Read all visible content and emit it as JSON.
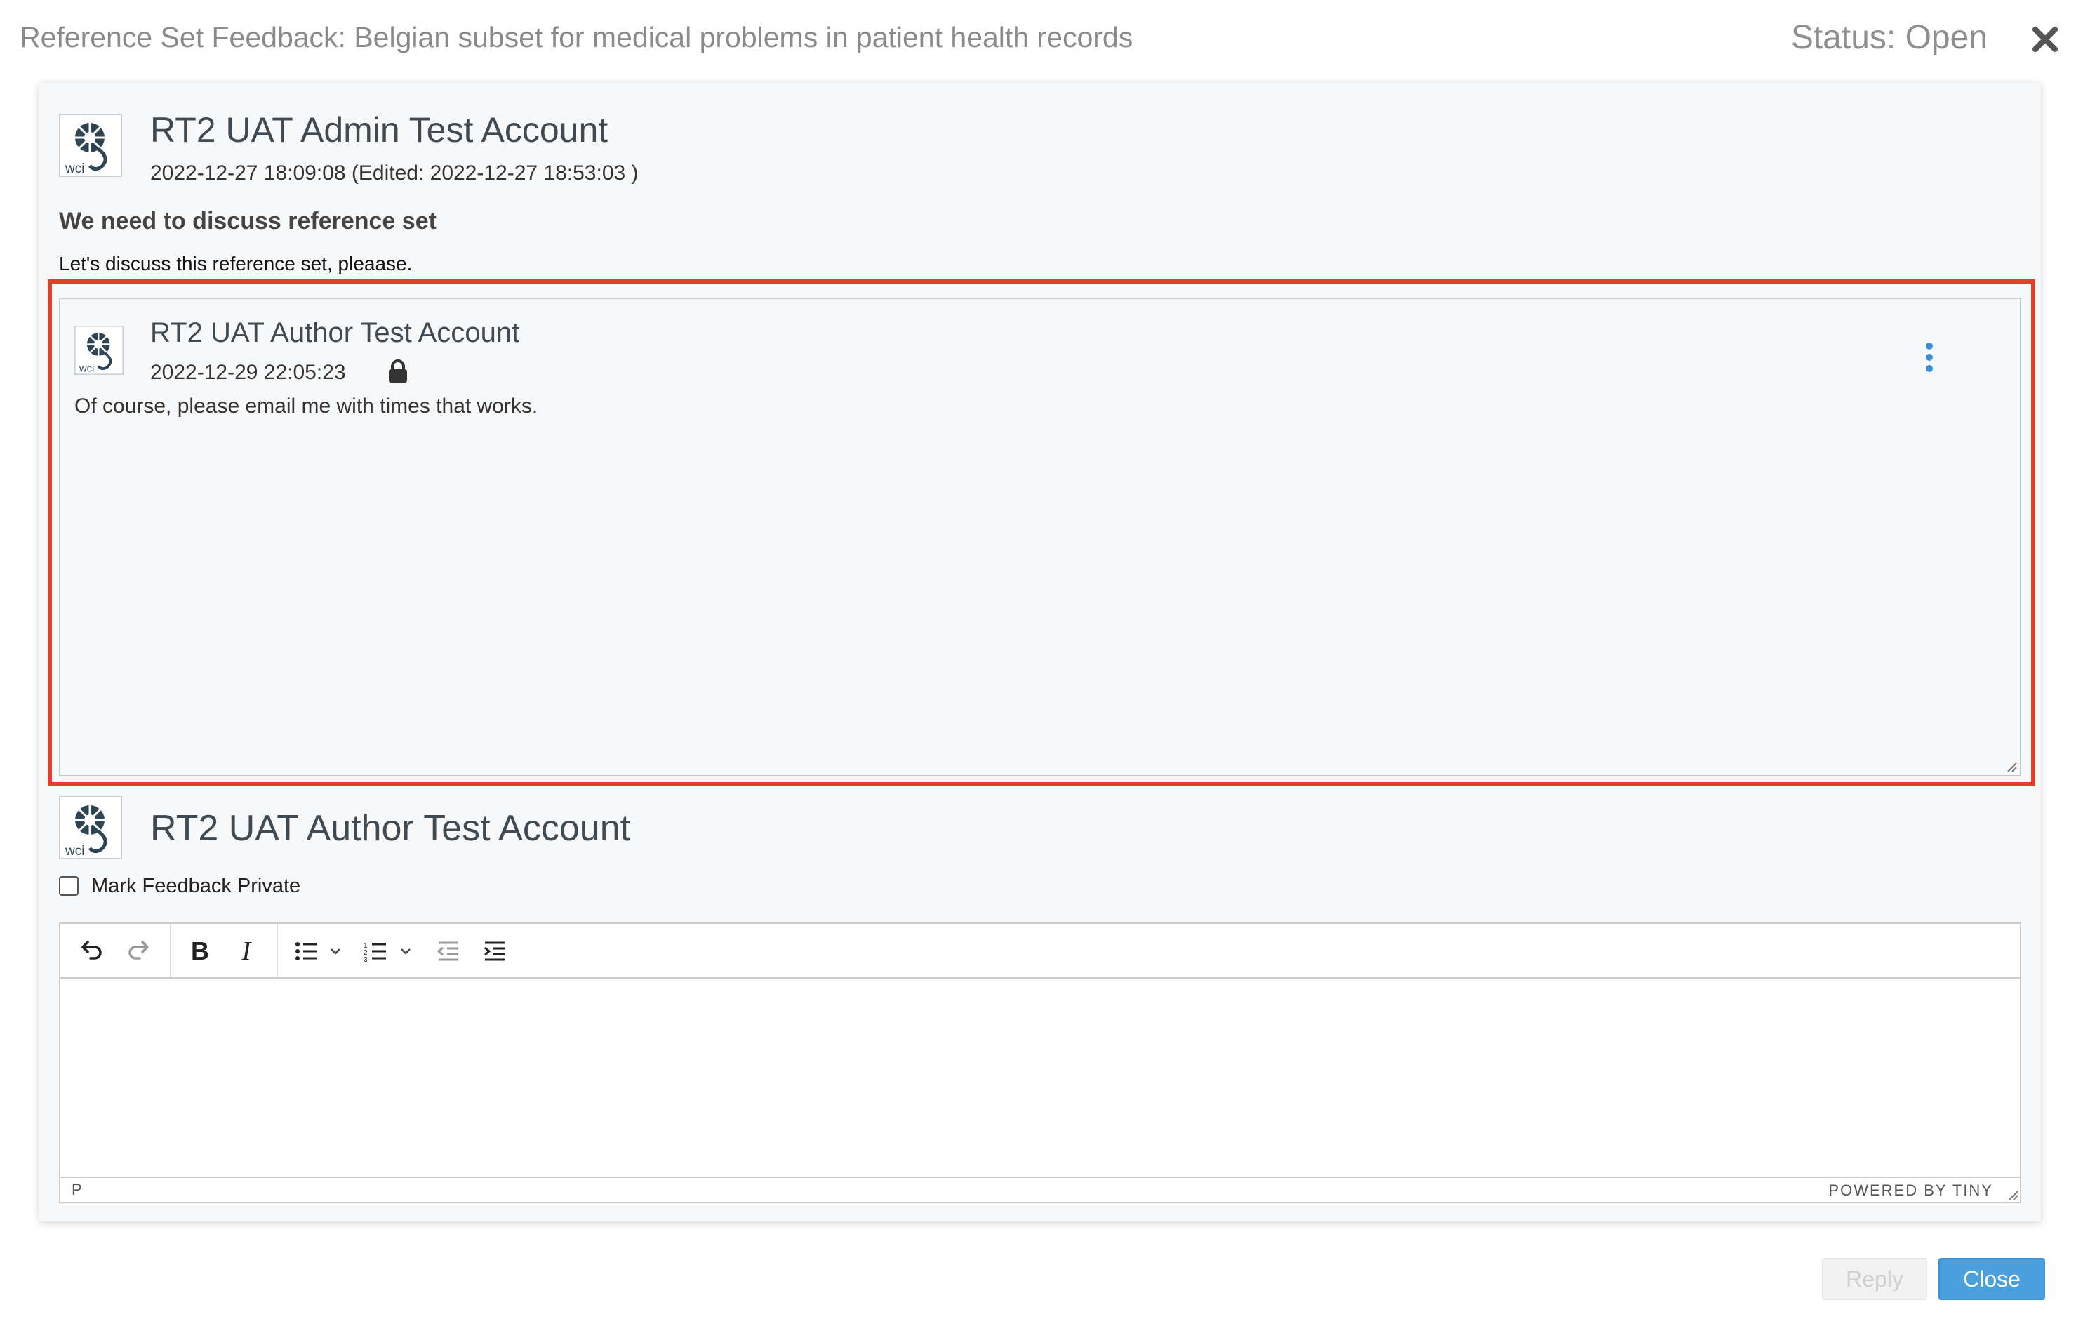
{
  "modal": {
    "title": "Reference Set Feedback: Belgian subset for medical problems in patient health records",
    "status": "Status: Open"
  },
  "icons": {
    "close": "close-x-icon",
    "avatar": "wci-logo-avatar",
    "lock": "lock-icon",
    "menu": "kebab-menu-icon"
  },
  "avatar_text": "wci",
  "post": {
    "author": "RT2 UAT Admin Test Account",
    "date": "2022-12-27 18:09:08 (Edited: 2022-12-27 18:53:03 )",
    "subject": "We need to discuss reference set",
    "body": "Let's discuss this reference set, pleaase."
  },
  "reply": {
    "author": "RT2 UAT Author Test Account",
    "date": "2022-12-29 22:05:23",
    "private": true,
    "body": "Of course, please email me with times that works."
  },
  "composer": {
    "author": "RT2 UAT Author Test Account",
    "private_label": "Mark Feedback Private",
    "private_checked": false,
    "toolbar": [
      "undo",
      "redo",
      "bold",
      "italic",
      "bullet-list",
      "numbered-list",
      "outdent",
      "indent"
    ],
    "path": "P",
    "brand": "POWERED BY TINY"
  },
  "buttons": {
    "reply": "Reply",
    "close": "Close"
  },
  "colors": {
    "highlight": "#e0402a",
    "primary": "#4aa0dc",
    "kebab": "#3a8ed8",
    "logo": "#2f4656"
  }
}
